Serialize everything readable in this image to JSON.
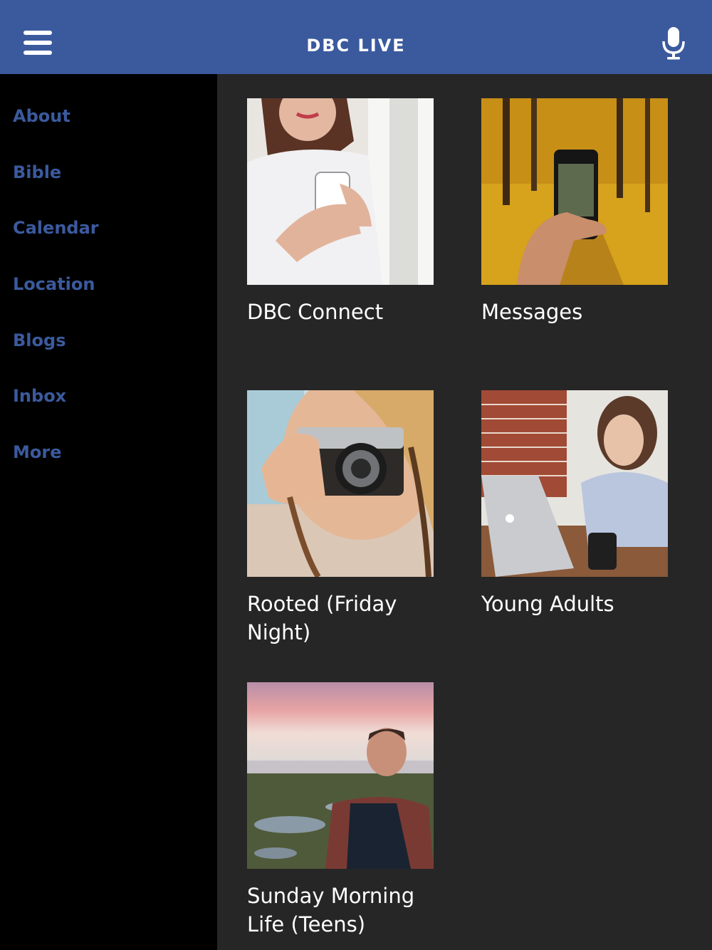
{
  "header": {
    "title": "DBC LIVE",
    "menu_icon": "hamburger-menu-icon",
    "mic_icon": "microphone-icon",
    "background": "#3b5a9e"
  },
  "sidebar": {
    "items": [
      {
        "label": "About"
      },
      {
        "label": "Bible"
      },
      {
        "label": "Calendar"
      },
      {
        "label": "Location"
      },
      {
        "label": "Blogs"
      },
      {
        "label": "Inbox"
      },
      {
        "label": "More"
      }
    ],
    "accent": "#3b5a9e"
  },
  "tiles": [
    {
      "label": "DBC Connect",
      "image": "woman-holding-smartphone"
    },
    {
      "label": "Messages",
      "image": "phone-photographing-autumn-forest"
    },
    {
      "label": "Rooted (Friday Night)",
      "image": "woman-with-vintage-camera"
    },
    {
      "label": "Young Adults",
      "image": "woman-working-on-laptop"
    },
    {
      "label": "Sunday Morning Life (Teens)",
      "image": "man-facing-sunset-beach"
    }
  ]
}
